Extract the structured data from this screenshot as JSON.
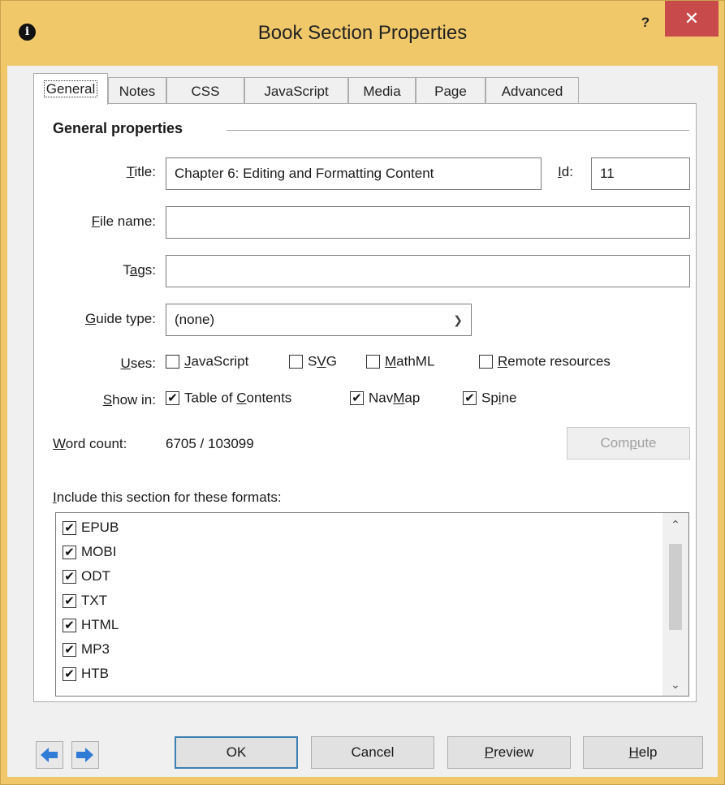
{
  "window": {
    "title": "Book Section Properties",
    "help": "?",
    "close": "✕"
  },
  "tabs": [
    "General",
    "Notes",
    "CSS",
    "JavaScript",
    "Media",
    "Page",
    "Advanced"
  ],
  "general": {
    "group_title": "General properties",
    "title_label_pre": "",
    "title_label_u": "T",
    "title_label_post": "itle:",
    "title_value": "Chapter 6: Editing and Formatting Content",
    "id_label_u": "I",
    "id_label_post": "d:",
    "id_value": "11",
    "filename_label_u": "F",
    "filename_label_post": "ile name:",
    "filename_value": "",
    "tags_label_pre": "T",
    "tags_label_u": "a",
    "tags_label_post": "gs:",
    "tags_value": "",
    "guide_label_u": "G",
    "guide_label_post": "uide type:",
    "guide_value": "(none)",
    "uses_label_u": "U",
    "uses_label_post": "ses:",
    "uses": [
      {
        "pre": "",
        "u": "J",
        "post": "avaScript",
        "checked": false
      },
      {
        "pre": "S",
        "u": "V",
        "post": "G",
        "checked": false
      },
      {
        "pre": "",
        "u": "M",
        "post": "athML",
        "checked": false
      },
      {
        "pre": "",
        "u": "R",
        "post": "emote resources",
        "checked": false
      }
    ],
    "showin_label_u": "S",
    "showin_label_post": "how in:",
    "showin": [
      {
        "pre": "Table of ",
        "u": "C",
        "post": "ontents",
        "checked": true
      },
      {
        "pre": "Nav",
        "u": "M",
        "post": "ap",
        "checked": true
      },
      {
        "pre": "Sp",
        "u": "i",
        "post": "ne",
        "checked": true
      }
    ],
    "wordcount_label_u": "W",
    "wordcount_label_post": "ord count:",
    "wordcount_value": "6705 / 103099",
    "compute_pre": "Com",
    "compute_u": "p",
    "compute_post": "ute",
    "formats_label_u": "I",
    "formats_label_post": "nclude this section for these formats:",
    "formats": [
      "EPUB",
      "MOBI",
      "ODT",
      "TXT",
      "HTML",
      "MP3",
      "HTB"
    ]
  },
  "footer": {
    "ok": "OK",
    "cancel": "Cancel",
    "preview_u": "P",
    "preview_post": "review",
    "help_u": "H",
    "help_post": "elp"
  },
  "colors": {
    "frame": "#f0c86a",
    "close": "#c94a4a",
    "arrow": "#2f7bd6"
  }
}
